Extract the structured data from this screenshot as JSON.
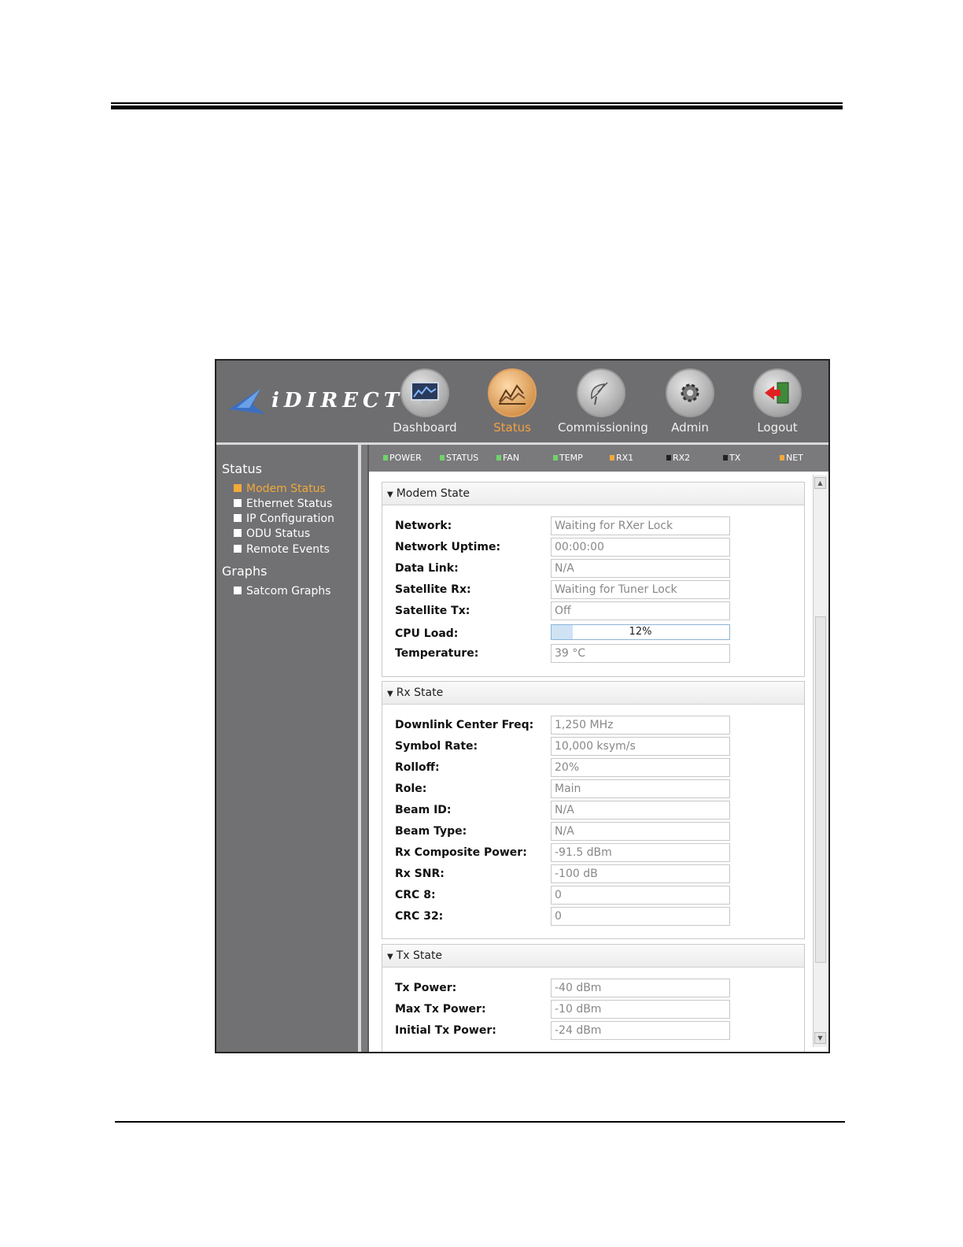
{
  "header": {
    "logo_text": "iDIRECT",
    "nav": [
      {
        "label": "Dashboard",
        "icon": "dashboard-monitor-icon",
        "active": false
      },
      {
        "label": "Status",
        "icon": "status-chart-icon",
        "active": true
      },
      {
        "label": "Commissioning",
        "icon": "satellite-dish-icon",
        "active": false
      },
      {
        "label": "Admin",
        "icon": "gear-icon",
        "active": false
      },
      {
        "label": "Logout",
        "icon": "logout-door-icon",
        "active": false
      }
    ]
  },
  "sidebar": {
    "status_heading": "Status",
    "status_items": [
      {
        "label": "Modem Status",
        "active": true
      },
      {
        "label": "Ethernet Status",
        "active": false
      },
      {
        "label": "IP Configuration",
        "active": false
      },
      {
        "label": "ODU Status",
        "active": false
      },
      {
        "label": "Remote Events",
        "active": false
      }
    ],
    "graphs_heading": "Graphs",
    "graphs_items": [
      {
        "label": "Satcom Graphs",
        "active": false
      }
    ]
  },
  "leds": [
    {
      "label": "POWER",
      "color": "#6fd36a"
    },
    {
      "label": "STATUS",
      "color": "#6fd36a"
    },
    {
      "label": "FAN",
      "color": "#6fd36a"
    },
    {
      "label": "TEMP",
      "color": "#6fd36a"
    },
    {
      "label": "RX1",
      "color": "#f2a83a"
    },
    {
      "label": "RX2",
      "color": "#222222"
    },
    {
      "label": "TX",
      "color": "#222222"
    },
    {
      "label": "NET",
      "color": "#f2a83a"
    }
  ],
  "modem_state": {
    "title": "Modem State",
    "rows": [
      {
        "label": "Network:",
        "value": "Waiting for RXer Lock"
      },
      {
        "label": "Network Uptime:",
        "value": "00:00:00"
      },
      {
        "label": "Data Link:",
        "value": "N/A"
      },
      {
        "label": "Satellite Rx:",
        "value": "Waiting for Tuner Lock"
      },
      {
        "label": "Satellite Tx:",
        "value": "Off"
      },
      {
        "label": "CPU Load:",
        "value": "12%",
        "progress": 0.12
      },
      {
        "label": "Temperature:",
        "value": "39 °C"
      }
    ]
  },
  "rx_state": {
    "title": "Rx State",
    "rows": [
      {
        "label": "Downlink Center Freq:",
        "value": "1,250 MHz"
      },
      {
        "label": "Symbol Rate:",
        "value": "10,000 ksym/s"
      },
      {
        "label": "Rolloff:",
        "value": "20%"
      },
      {
        "label": "Role:",
        "value": "Main"
      },
      {
        "label": "Beam ID:",
        "value": "N/A"
      },
      {
        "label": "Beam Type:",
        "value": "N/A"
      },
      {
        "label": "Rx Composite Power:",
        "value": "-91.5 dBm"
      },
      {
        "label": "Rx SNR:",
        "value": "-100 dB"
      },
      {
        "label": "CRC 8:",
        "value": "0"
      },
      {
        "label": "CRC 32:",
        "value": "0"
      }
    ]
  },
  "tx_state": {
    "title": "Tx State",
    "rows": [
      {
        "label": "Tx Power:",
        "value": "-40 dBm"
      },
      {
        "label": "Max Tx Power:",
        "value": "-10 dBm"
      },
      {
        "label": "Initial Tx Power:",
        "value": "-24 dBm"
      }
    ]
  }
}
